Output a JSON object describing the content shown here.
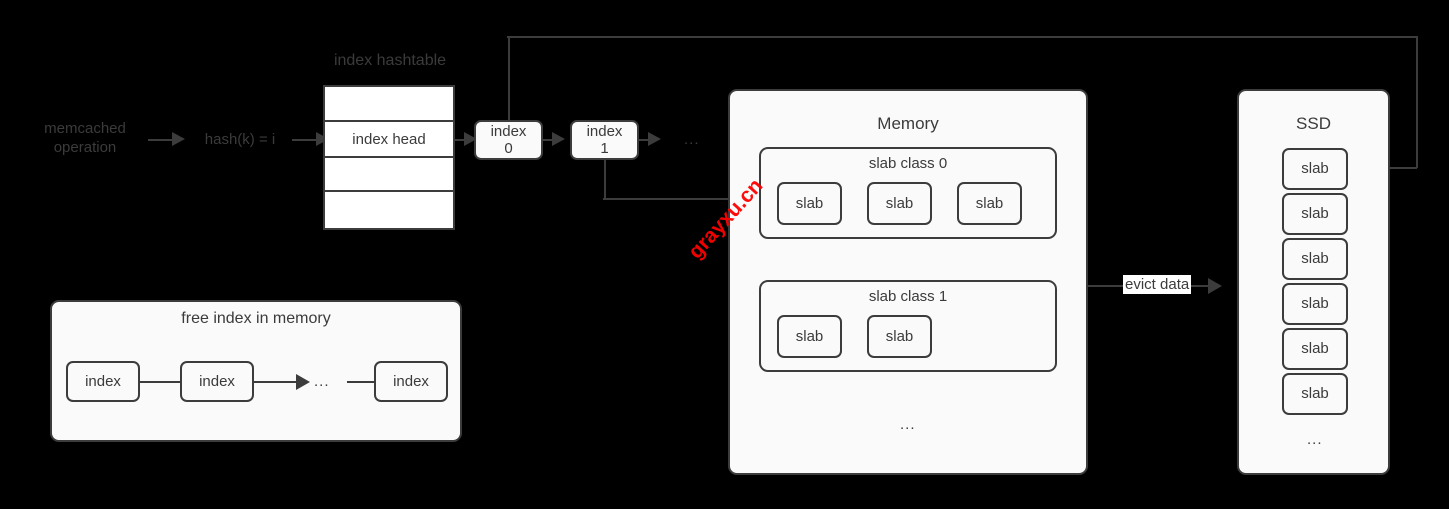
{
  "diagram": {
    "title": "memcached index hashtable / slab memory / SSD eviction flow",
    "colors": {
      "background": "#000000",
      "node_fill": "#fafafa",
      "stroke": "#3c3c3c",
      "text": "#3b3b3b",
      "watermark": "#ff0000"
    }
  },
  "flow": {
    "source_label": "memcached\noperation",
    "hash_label": "hash(k) = i"
  },
  "hashtable": {
    "title": "index hashtable",
    "rows": [
      "",
      "index head",
      "",
      ""
    ]
  },
  "index_chain": {
    "nodes": [
      {
        "label": "index\n0"
      },
      {
        "label": "index\n1"
      }
    ],
    "ellipsis": "..."
  },
  "memory": {
    "title": "Memory",
    "ellipsis": "...",
    "slab_classes": [
      {
        "title": "slab class 0",
        "slabs": [
          "slab",
          "slab",
          "slab"
        ]
      },
      {
        "title": "slab class 1",
        "slabs": [
          "slab",
          "slab"
        ]
      }
    ]
  },
  "ssd": {
    "title": "SSD",
    "slabs": [
      "slab",
      "slab",
      "slab",
      "slab",
      "slab",
      "slab"
    ],
    "ellipsis": "..."
  },
  "free_index": {
    "title": "free index in memory",
    "nodes": [
      "index",
      "index",
      "index"
    ],
    "ellipsis": "..."
  },
  "edges": {
    "evict_label": "evict data"
  },
  "watermark": {
    "text": "grayxu.cn"
  }
}
